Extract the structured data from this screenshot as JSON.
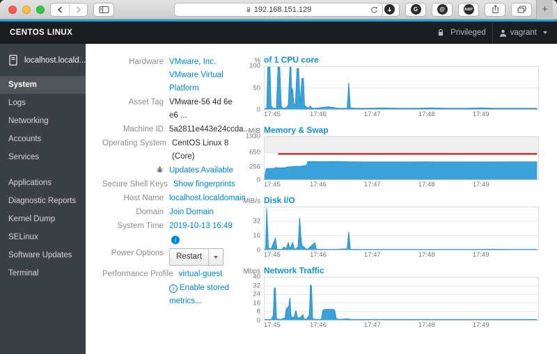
{
  "browser": {
    "url": "192.168.151.129",
    "traffic_lights": [
      "#fc5b57",
      "#fdbe3f",
      "#33c748"
    ],
    "extension_g_glyph": "G",
    "extension_at_glyph": "@",
    "adblock_glyph": "ABP",
    "new_tab_glyph": "+"
  },
  "navbar": {
    "brand": "CENTOS LINUX",
    "privileged_label": "Privileged",
    "user_label": "vagrant"
  },
  "sidebar": {
    "host": "localhost.locald...",
    "items": [
      {
        "label": "System",
        "selected": true
      },
      {
        "label": "Logs"
      },
      {
        "label": "Networking"
      },
      {
        "label": "Accounts"
      },
      {
        "label": "Services"
      },
      {
        "label": "Applications",
        "gap_before": true
      },
      {
        "label": "Diagnostic Reports"
      },
      {
        "label": "Kernel Dump"
      },
      {
        "label": "SELinux"
      },
      {
        "label": "Software Updates"
      },
      {
        "label": "Terminal"
      }
    ]
  },
  "info": {
    "rows": [
      {
        "name": "hardware",
        "label": "Hardware",
        "value": "VMware, Inc. VMware Virtual Platform",
        "type": "link"
      },
      {
        "name": "asset-tag",
        "label": "Asset Tag",
        "value": "VMware-56 4d 6e e6 ...",
        "type": "text"
      },
      {
        "name": "machine-id",
        "label": "Machine ID",
        "value": "5a2811e443e24ccda...",
        "type": "text"
      },
      {
        "name": "operating-system",
        "label": "Operating System",
        "value": "CentOS Linux 8 (Core)",
        "type": "text"
      },
      {
        "name": "updates-available",
        "label": "",
        "label_icon": "bug",
        "value": "Updates Available",
        "type": "link"
      },
      {
        "name": "secure-shell-keys",
        "label": "Secure Shell Keys",
        "value": "Show fingerprints",
        "type": "link"
      },
      {
        "name": "host-name",
        "label": "Host Name",
        "value": "localhost.localdomain",
        "type": "link"
      },
      {
        "name": "domain",
        "label": "Domain",
        "value": "Join Domain",
        "type": "link"
      },
      {
        "name": "system-time",
        "label": "System Time",
        "value": "2019-10-13 16:49",
        "type": "link",
        "suffix_icon": "info"
      },
      {
        "name": "power-options",
        "label": "Power Options",
        "value": "Restart",
        "type": "button"
      },
      {
        "name": "performance-profile",
        "label": "Performance Profile",
        "value": "virtual-guest",
        "type": "link"
      },
      {
        "name": "enable-stored-metrics",
        "label": "",
        "value": "Enable stored metrics...",
        "type": "link",
        "prefix_icon": "info-outline"
      }
    ]
  },
  "chart_data": [
    {
      "type": "area",
      "unit": "%",
      "title": "of 1 CPU core",
      "x_ticks": [
        {
          "t": 0,
          "label": "17:45"
        },
        {
          "t": 1,
          "label": "17:46"
        },
        {
          "t": 2,
          "label": "17:47"
        },
        {
          "t": 3,
          "label": "17:48"
        },
        {
          "t": 4,
          "label": "17:49"
        }
      ],
      "x_max_minutes": 5.07,
      "y_scale": [
        [
          0,
          0
        ],
        [
          100,
          1
        ]
      ],
      "y_ticks": [
        {
          "label": "100",
          "value": 100
        },
        {
          "label": "50",
          "value": 50
        },
        {
          "label": "0",
          "value": 0
        }
      ],
      "series": [
        {
          "name": "cpu-usage",
          "type": "area",
          "color": "#3ba3da",
          "stroke": "#2791c9",
          "points": [
            [
              0,
              2
            ],
            [
              0.04,
              2
            ],
            [
              0.06,
              100
            ],
            [
              0.1,
              100
            ],
            [
              0.12,
              8
            ],
            [
              0.16,
              2
            ],
            [
              0.22,
              2
            ],
            [
              0.25,
              100
            ],
            [
              0.28,
              100
            ],
            [
              0.31,
              6
            ],
            [
              0.36,
              2
            ],
            [
              0.4,
              3
            ],
            [
              0.44,
              10
            ],
            [
              0.47,
              100
            ],
            [
              0.49,
              100
            ],
            [
              0.5,
              35
            ],
            [
              0.52,
              50
            ],
            [
              0.54,
              15
            ],
            [
              0.57,
              8
            ],
            [
              0.6,
              95
            ],
            [
              0.63,
              96
            ],
            [
              0.66,
              12
            ],
            [
              0.69,
              72
            ],
            [
              0.72,
              73
            ],
            [
              0.74,
              10
            ],
            [
              0.78,
              4
            ],
            [
              0.82,
              3
            ],
            [
              0.85,
              8
            ],
            [
              0.87,
              3
            ],
            [
              0.92,
              2
            ],
            [
              1.0,
              3
            ],
            [
              1.05,
              4
            ],
            [
              1.1,
              5
            ],
            [
              1.15,
              5
            ],
            [
              1.18,
              6
            ],
            [
              1.22,
              5
            ],
            [
              1.28,
              4
            ],
            [
              1.35,
              2
            ],
            [
              1.45,
              2
            ],
            [
              1.53,
              2
            ],
            [
              1.56,
              62
            ],
            [
              1.59,
              3
            ],
            [
              1.7,
              2
            ],
            [
              1.9,
              2
            ],
            [
              2.2,
              3
            ],
            [
              2.5,
              2
            ],
            [
              2.8,
              2
            ],
            [
              3.1,
              3
            ],
            [
              3.4,
              2
            ],
            [
              3.7,
              2
            ],
            [
              4.0,
              3
            ],
            [
              4.3,
              2
            ],
            [
              4.6,
              2
            ],
            [
              4.9,
              2
            ],
            [
              5.05,
              2
            ]
          ]
        }
      ]
    },
    {
      "type": "area",
      "unit": "MiB",
      "title": "Memory & Swap",
      "x_ticks": [
        {
          "t": 0,
          "label": "17:45"
        },
        {
          "t": 1,
          "label": "17:46"
        },
        {
          "t": 2,
          "label": "17:47"
        },
        {
          "t": 3,
          "label": "17:48"
        },
        {
          "t": 4,
          "label": "17:49"
        }
      ],
      "x_max_minutes": 5.07,
      "y_scale": [
        [
          0,
          0
        ],
        [
          256,
          0.3
        ],
        [
          650,
          0.63
        ],
        [
          1930,
          1.0
        ]
      ],
      "y_ticks": [
        {
          "label": "1930",
          "value": 1930
        },
        {
          "label": "650",
          "value": 650
        },
        {
          "label": "256",
          "value": 256
        },
        {
          "label": "0",
          "value": 0
        }
      ],
      "band": {
        "from": 650,
        "to": 1930,
        "color": "#efefef",
        "edge": "#d0d0d0"
      },
      "series": [
        {
          "name": "memory-used",
          "type": "area",
          "color": "#3ba3da",
          "stroke": "#2791c9",
          "points": [
            [
              0,
              50
            ],
            [
              0.03,
              215
            ],
            [
              0.1,
              218
            ],
            [
              0.18,
              222
            ],
            [
              0.21,
              242
            ],
            [
              0.24,
              228
            ],
            [
              0.3,
              230
            ],
            [
              0.36,
              232
            ],
            [
              0.42,
              248
            ],
            [
              0.5,
              258
            ],
            [
              0.58,
              264
            ],
            [
              0.65,
              268
            ],
            [
              0.7,
              275
            ],
            [
              0.74,
              282
            ],
            [
              0.78,
              290
            ],
            [
              0.8,
              398
            ],
            [
              0.9,
              402
            ],
            [
              1.0,
              400
            ],
            [
              1.1,
              398
            ],
            [
              1.25,
              402
            ],
            [
              1.4,
              400
            ],
            [
              1.6,
              392
            ],
            [
              2.0,
              390
            ],
            [
              2.5,
              390
            ],
            [
              3.0,
              391
            ],
            [
              3.5,
              390
            ],
            [
              4.0,
              390
            ],
            [
              4.5,
              391
            ],
            [
              5.05,
              392
            ]
          ]
        },
        {
          "name": "swap-used",
          "type": "line",
          "color": "#cc0000",
          "points": [
            [
              0.25,
              615
            ],
            [
              5.05,
              615
            ]
          ]
        }
      ]
    },
    {
      "type": "area",
      "unit": "MiB/s",
      "title": "Disk I/O",
      "x_ticks": [
        {
          "t": 0,
          "label": "17:45"
        },
        {
          "t": 1,
          "label": "17:46"
        },
        {
          "t": 2,
          "label": "17:47"
        },
        {
          "t": 3,
          "label": "17:48"
        },
        {
          "t": 4,
          "label": "17:49"
        }
      ],
      "x_max_minutes": 5.07,
      "y_scale": [
        [
          0,
          0
        ],
        [
          48,
          1
        ]
      ],
      "y_ticks": [
        {
          "label": "32",
          "value": 32
        },
        {
          "label": "16",
          "value": 16
        },
        {
          "label": "0",
          "value": 0
        }
      ],
      "series": [
        {
          "name": "disk-io",
          "type": "area",
          "color": "#3ba3da",
          "stroke": "#2791c9",
          "points": [
            [
              0,
              0.3
            ],
            [
              0.02,
              1
            ],
            [
              0.04,
              47
            ],
            [
              0.07,
              2
            ],
            [
              0.12,
              0.5
            ],
            [
              0.2,
              13
            ],
            [
              0.23,
              0.5
            ],
            [
              0.32,
              0.4
            ],
            [
              0.36,
              3
            ],
            [
              0.4,
              1
            ],
            [
              0.44,
              8
            ],
            [
              0.47,
              1
            ],
            [
              0.52,
              8
            ],
            [
              0.55,
              1
            ],
            [
              0.58,
              1
            ],
            [
              0.62,
              3
            ],
            [
              0.65,
              36
            ],
            [
              0.68,
              10
            ],
            [
              0.7,
              4
            ],
            [
              0.73,
              3
            ],
            [
              0.76,
              1
            ],
            [
              0.8,
              0.5
            ],
            [
              0.93,
              8
            ],
            [
              0.96,
              0.5
            ],
            [
              1.1,
              0.3
            ],
            [
              1.3,
              0.3
            ],
            [
              1.53,
              1
            ],
            [
              1.56,
              20
            ],
            [
              1.59,
              0.5
            ],
            [
              1.8,
              0.3
            ],
            [
              2.2,
              0.3
            ],
            [
              2.6,
              0.3
            ],
            [
              3.0,
              0.3
            ],
            [
              3.4,
              0.3
            ],
            [
              3.8,
              0.3
            ],
            [
              4.2,
              0.5
            ],
            [
              4.6,
              0.3
            ],
            [
              5.05,
              0.3
            ]
          ]
        }
      ]
    },
    {
      "type": "area",
      "unit": "Mbps",
      "title": "Network Traffic",
      "x_ticks": [
        {
          "t": 0,
          "label": "17:45"
        },
        {
          "t": 1,
          "label": "17:46"
        },
        {
          "t": 2,
          "label": "17:47"
        },
        {
          "t": 3,
          "label": "17:48"
        },
        {
          "t": 4,
          "label": "17:49"
        }
      ],
      "x_max_minutes": 5.07,
      "y_scale": [
        [
          0,
          0
        ],
        [
          40,
          1
        ]
      ],
      "y_ticks": [
        {
          "label": "40",
          "value": 40
        },
        {
          "label": "32",
          "value": 32
        },
        {
          "label": "24",
          "value": 24
        },
        {
          "label": "16",
          "value": 16
        },
        {
          "label": "8",
          "value": 8
        },
        {
          "label": "0",
          "value": 0
        }
      ],
      "series": [
        {
          "name": "network-traffic",
          "type": "area",
          "color": "#3ba3da",
          "stroke": "#2791c9",
          "points": [
            [
              0,
              0.4
            ],
            [
              0.12,
              0.4
            ],
            [
              0.16,
              4
            ],
            [
              0.18,
              30
            ],
            [
              0.2,
              30
            ],
            [
              0.22,
              1
            ],
            [
              0.3,
              0.4
            ],
            [
              0.38,
              2
            ],
            [
              0.4,
              10
            ],
            [
              0.43,
              12
            ],
            [
              0.45,
              13
            ],
            [
              0.47,
              21
            ],
            [
              0.49,
              4
            ],
            [
              0.52,
              2
            ],
            [
              0.55,
              3
            ],
            [
              0.58,
              9
            ],
            [
              0.61,
              2
            ],
            [
              0.65,
              2
            ],
            [
              0.68,
              3
            ],
            [
              0.71,
              5
            ],
            [
              0.73,
              1
            ],
            [
              0.78,
              0.5
            ],
            [
              0.83,
              5
            ],
            [
              0.85,
              33
            ],
            [
              0.87,
              32
            ],
            [
              0.89,
              1
            ],
            [
              0.95,
              0.5
            ],
            [
              1.05,
              0.5
            ],
            [
              1.08,
              9
            ],
            [
              1.12,
              10
            ],
            [
              1.2,
              10
            ],
            [
              1.28,
              10
            ],
            [
              1.3,
              9
            ],
            [
              1.33,
              1
            ],
            [
              1.4,
              0.5
            ],
            [
              1.52,
              1
            ],
            [
              1.56,
              1
            ],
            [
              1.6,
              0.4
            ],
            [
              1.8,
              0.4
            ],
            [
              2.2,
              0.4
            ],
            [
              2.6,
              0.4
            ],
            [
              3.0,
              0.4
            ],
            [
              3.4,
              0.4
            ],
            [
              3.8,
              0.4
            ],
            [
              4.2,
              0.4
            ],
            [
              4.6,
              0.4
            ],
            [
              5.05,
              0.4
            ]
          ]
        }
      ]
    }
  ]
}
